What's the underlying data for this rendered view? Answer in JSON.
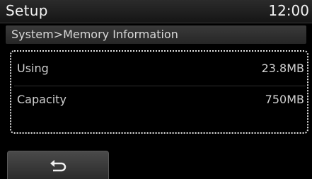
{
  "header": {
    "title": "Setup",
    "time": "12:00"
  },
  "breadcrumb": {
    "text": "System>Memory Information"
  },
  "memory": {
    "rows": [
      {
        "label": "Using",
        "value": "23.8MB"
      },
      {
        "label": "Capacity",
        "value": "750MB"
      }
    ]
  },
  "back_button": {
    "icon": "back-arrow-icon"
  }
}
